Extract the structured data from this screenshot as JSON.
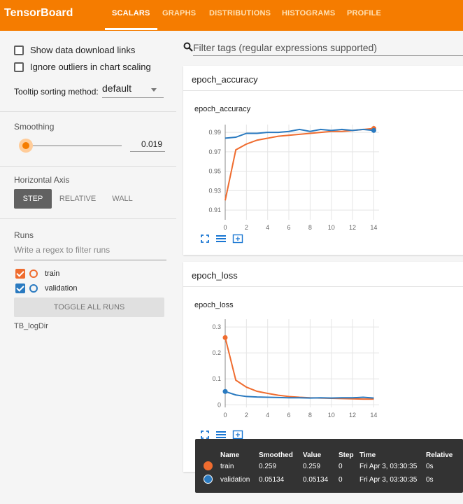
{
  "app": {
    "brand": "TensorBoard",
    "tabs": [
      "SCALARS",
      "GRAPHS",
      "DISTRIBUTIONS",
      "HISTOGRAMS",
      "PROFILE"
    ]
  },
  "sidebar": {
    "show_download_links": "Show data download links",
    "ignore_outliers": "Ignore outliers in chart scaling",
    "tooltip_sorting_label": "Tooltip sorting method:",
    "tooltip_sorting_value": "default",
    "smoothing_label": "Smoothing",
    "smoothing_value": "0.019",
    "horizontal_axis_label": "Horizontal Axis",
    "axis_options": [
      "STEP",
      "RELATIVE",
      "WALL"
    ],
    "runs_label": "Runs",
    "runs_filter_placeholder": "Write a regex to filter runs",
    "runs": [
      {
        "name": "train",
        "color": "#ef6c2f"
      },
      {
        "name": "validation",
        "color": "#2a7ac0"
      }
    ],
    "toggle_all": "TOGGLE ALL RUNS",
    "logdir": "TB_logDir"
  },
  "main": {
    "search_placeholder": "Filter tags (regular expressions supported)",
    "cards": [
      {
        "header": "epoch_accuracy",
        "title": "epoch_accuracy"
      },
      {
        "header": "epoch_loss",
        "title": "epoch_loss"
      }
    ]
  },
  "chart_data": [
    {
      "type": "line",
      "title": "epoch_accuracy",
      "x": [
        0,
        1,
        2,
        3,
        4,
        5,
        6,
        7,
        8,
        9,
        10,
        11,
        12,
        13,
        14
      ],
      "xticks": [
        0,
        2,
        4,
        6,
        8,
        10,
        12,
        14
      ],
      "yticks": [
        "0.91",
        "0.93",
        "0.95",
        "0.97",
        "0.99"
      ],
      "ylim": [
        0.9,
        0.998
      ],
      "series": [
        {
          "name": "train",
          "color": "#ef6c2f",
          "values": [
            0.92,
            0.972,
            0.978,
            0.982,
            0.984,
            0.986,
            0.987,
            0.988,
            0.989,
            0.99,
            0.991,
            0.991,
            0.992,
            0.993,
            0.994
          ]
        },
        {
          "name": "validation",
          "color": "#2a7ac0",
          "values": [
            0.984,
            0.985,
            0.989,
            0.989,
            0.99,
            0.99,
            0.991,
            0.993,
            0.991,
            0.993,
            0.992,
            0.993,
            0.992,
            0.993,
            0.992
          ]
        }
      ]
    },
    {
      "type": "line",
      "title": "epoch_loss",
      "x": [
        0,
        1,
        2,
        3,
        4,
        5,
        6,
        7,
        8,
        9,
        10,
        11,
        12,
        13,
        14
      ],
      "xticks": [
        0,
        2,
        4,
        6,
        8,
        10,
        12,
        14
      ],
      "yticks": [
        "0",
        "0.1",
        "0.2",
        "0.3"
      ],
      "ylim": [
        -0.01,
        0.33
      ],
      "series": [
        {
          "name": "train",
          "color": "#ef6c2f",
          "values": [
            0.259,
            0.095,
            0.068,
            0.052,
            0.044,
            0.037,
            0.032,
            0.029,
            0.027,
            0.026,
            0.025,
            0.024,
            0.023,
            0.022,
            0.022
          ]
        },
        {
          "name": "validation",
          "color": "#2a7ac0",
          "values": [
            0.05134,
            0.038,
            0.032,
            0.03,
            0.029,
            0.028,
            0.027,
            0.027,
            0.026,
            0.027,
            0.026,
            0.027,
            0.027,
            0.029,
            0.026
          ]
        }
      ]
    }
  ],
  "tooltip": {
    "headers": [
      "Name",
      "Smoothed",
      "Value",
      "Step",
      "Time",
      "Relative"
    ],
    "rows": [
      {
        "color": "#ef6c2f",
        "cells": [
          "train",
          "0.259",
          "0.259",
          "0",
          "Fri Apr 3, 03:30:35",
          "0s"
        ]
      },
      {
        "color": "#2a7ac0",
        "cells": [
          "validation",
          "0.05134",
          "0.05134",
          "0",
          "Fri Apr 3, 03:30:35",
          "0s"
        ]
      }
    ]
  }
}
